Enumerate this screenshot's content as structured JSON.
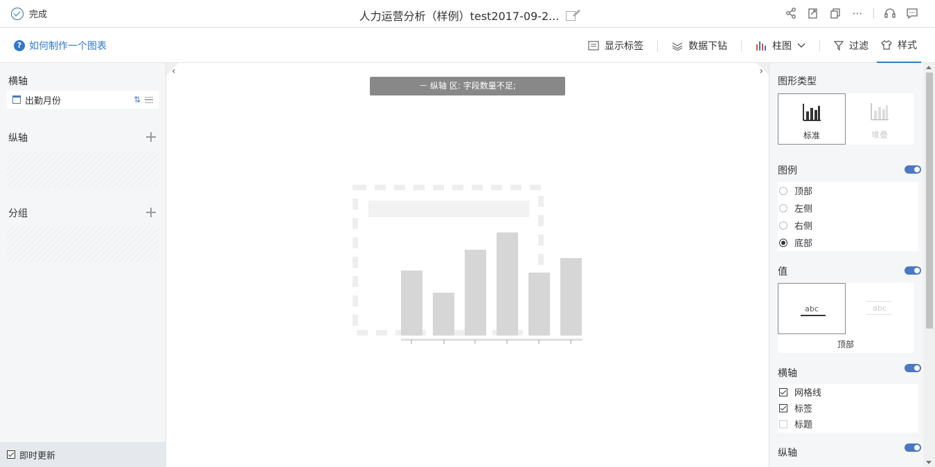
{
  "header": {
    "done_label": "完成",
    "title": "人力运营分析（样例）test2017-09-2..."
  },
  "toolbar": {
    "howto_label": "如何制作一个图表",
    "show_labels": "显示标签",
    "drilldown": "数据下钻",
    "chart_type": "柱图",
    "filter": "过滤",
    "style": "样式"
  },
  "left": {
    "x_axis_label": "横轴",
    "x_field": "出勤月份",
    "y_axis_label": "纵轴",
    "group_label": "分组",
    "instant_update": "即时更新"
  },
  "canvas": {
    "warning": "－ 纵轴 区: 字段数量不足;"
  },
  "right": {
    "chart_type_title": "图形类型",
    "type_standard": "标准",
    "type_stacked": "堆叠",
    "legend_title": "图例",
    "legend_options": [
      "顶部",
      "左侧",
      "右侧",
      "底部"
    ],
    "legend_selected": 3,
    "value_title": "值",
    "value_sample": "abc",
    "value_position": "顶部",
    "x_axis_title": "横轴",
    "x_axis_options": [
      {
        "label": "网格线",
        "checked": true
      },
      {
        "label": "标签",
        "checked": true
      },
      {
        "label": "标题",
        "checked": false
      }
    ],
    "y_axis_title": "纵轴"
  }
}
